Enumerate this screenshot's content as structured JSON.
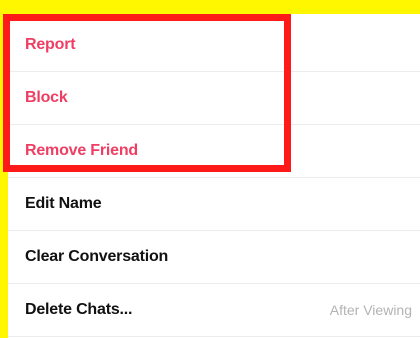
{
  "menu": {
    "danger_items": [
      {
        "label": "Report"
      },
      {
        "label": "Block"
      },
      {
        "label": "Remove Friend"
      }
    ],
    "items": [
      {
        "label": "Edit Name",
        "value": ""
      },
      {
        "label": "Clear Conversation",
        "value": ""
      },
      {
        "label": "Delete Chats...",
        "value": "After Viewing"
      }
    ]
  },
  "colors": {
    "background": "#FFF700",
    "danger_text": "#EE3E63",
    "highlight_border": "#FF1A1A",
    "secondary_text": "#B3B3B3"
  }
}
